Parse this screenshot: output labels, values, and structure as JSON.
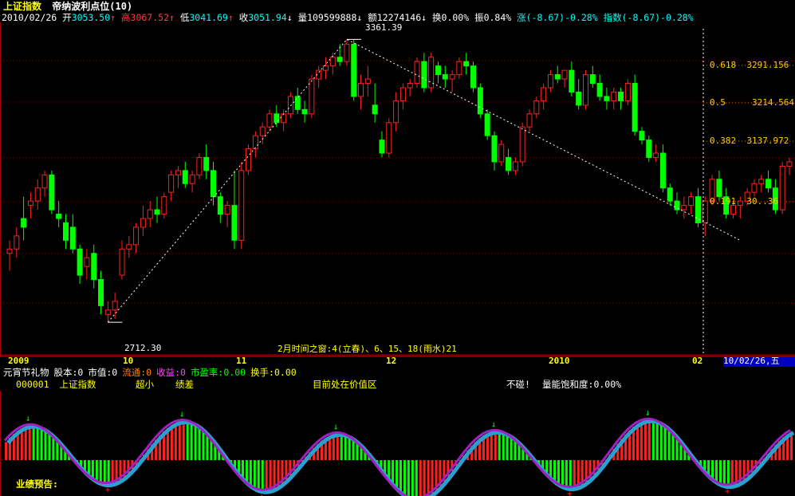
{
  "header": {
    "title": "上证指数",
    "indicator": "帝纳波利点位(10)",
    "date": "2010/02/26",
    "open_label": "开",
    "open": "3053.50",
    "high_label": "高",
    "high": "3067.52",
    "low_label": "低",
    "low": "3041.69",
    "close_label": "收",
    "close": "3051.94",
    "volume_label": "量",
    "volume": "109599888",
    "amount_label": "额",
    "amount": "12274146",
    "turnover_label": "换",
    "turnover": "0.00%",
    "amplitude_label": "振",
    "amplitude": "0.84%",
    "change_label": "涨",
    "change": "(-8.67)-0.28%",
    "index_label": "指数",
    "index_change": "(-8.67)-0.28%"
  },
  "annotations": {
    "peak": "3361.39",
    "trough": "2712.30",
    "time_window": "2月时间之窗:4(立春)、6、15、18(雨水)21"
  },
  "fib_levels": [
    {
      "ratio": "0.618",
      "value": "3291.156"
    },
    {
      "ratio": "0.5",
      "value": "3214.564"
    },
    {
      "ratio": "0.382",
      "value": "3137.972"
    },
    {
      "ratio": "0.191",
      "value": "30..36"
    }
  ],
  "time_axis": {
    "labels": [
      "2009",
      "10",
      "11",
      "12",
      "2010",
      "02"
    ],
    "cursor": "10/02/26,五"
  },
  "info_bar": {
    "line1": [
      {
        "text": "元宵节礼物",
        "color": "#ffffff"
      },
      {
        "text": "股本:0",
        "color": "#ffffff"
      },
      {
        "text": "市值:0",
        "color": "#ffffff"
      },
      {
        "text": "流通:0",
        "color": "#ff8000"
      },
      {
        "text": "收益:0",
        "color": "#ff40ff"
      },
      {
        "text": "市盈率:0.00",
        "color": "#00ff00"
      },
      {
        "text": "换手:0.00",
        "color": "#ffff00"
      }
    ],
    "code": "000001",
    "name": "上证指数",
    "size": "超小",
    "performance": "绩差",
    "status": "目前处在价值区",
    "warning": "不碰!",
    "saturation_label": "量能饱和度:",
    "saturation": "0.00%"
  },
  "footer": {
    "forecast_label": "业绩预告:"
  },
  "chart_data": {
    "type": "candlestick",
    "title": "上证指数",
    "ylim": [
      2650,
      3400
    ],
    "candles": [
      [
        2870,
        2900,
        2830,
        2880
      ],
      [
        2880,
        2930,
        2860,
        2910
      ],
      [
        2950,
        3000,
        2900,
        2930
      ],
      [
        2980,
        3010,
        2950,
        2990
      ],
      [
        2990,
        3040,
        2970,
        3020
      ],
      [
        3020,
        3060,
        3000,
        3050
      ],
      [
        3050,
        3060,
        2960,
        2970
      ],
      [
        2960,
        2990,
        2930,
        2950
      ],
      [
        2940,
        2960,
        2880,
        2900
      ],
      [
        2930,
        2960,
        2870,
        2880
      ],
      [
        2880,
        2890,
        2800,
        2820
      ],
      [
        2840,
        2880,
        2810,
        2860
      ],
      [
        2870,
        2890,
        2790,
        2810
      ],
      [
        2810,
        2830,
        2730,
        2750
      ],
      [
        2730,
        2760,
        2712,
        2740
      ],
      [
        2740,
        2780,
        2720,
        2760
      ],
      [
        2820,
        2900,
        2810,
        2880
      ],
      [
        2880,
        2910,
        2860,
        2890
      ],
      [
        2890,
        2940,
        2870,
        2930
      ],
      [
        2930,
        2980,
        2910,
        2950
      ],
      [
        2950,
        2990,
        2930,
        2970
      ],
      [
        2970,
        3000,
        2940,
        2960
      ],
      [
        2960,
        3010,
        2950,
        3000
      ],
      [
        3010,
        3060,
        2990,
        3050
      ],
      [
        3050,
        3070,
        3020,
        3060
      ],
      [
        3060,
        3080,
        3020,
        3030
      ],
      [
        3030,
        3060,
        3010,
        3050
      ],
      [
        3050,
        3100,
        3040,
        3090
      ],
      [
        3090,
        3120,
        3040,
        3060
      ],
      [
        3060,
        3080,
        2980,
        3000
      ],
      [
        3000,
        3010,
        2940,
        2960
      ],
      [
        2960,
        2990,
        2930,
        2980
      ],
      [
        2980,
        3060,
        2880,
        2900
      ],
      [
        2900,
        3080,
        2880,
        3060
      ],
      [
        3060,
        3120,
        3050,
        3110
      ],
      [
        3110,
        3150,
        3090,
        3140
      ],
      [
        3140,
        3170,
        3120,
        3160
      ],
      [
        3160,
        3200,
        3150,
        3190
      ],
      [
        3190,
        3210,
        3160,
        3170
      ],
      [
        3170,
        3200,
        3150,
        3190
      ],
      [
        3190,
        3240,
        3180,
        3230
      ],
      [
        3230,
        3250,
        3190,
        3200
      ],
      [
        3200,
        3220,
        3170,
        3190
      ],
      [
        3190,
        3280,
        3180,
        3270
      ],
      [
        3270,
        3300,
        3250,
        3290
      ],
      [
        3290,
        3320,
        3270,
        3300
      ],
      [
        3300,
        3330,
        3280,
        3320
      ],
      [
        3320,
        3350,
        3300,
        3310
      ],
      [
        3310,
        3361,
        3300,
        3350
      ],
      [
        3350,
        3361,
        3220,
        3230
      ],
      [
        3230,
        3280,
        3200,
        3260
      ],
      [
        3260,
        3300,
        3230,
        3270
      ],
      [
        3210,
        3260,
        3170,
        3190
      ],
      [
        3130,
        3150,
        3090,
        3100
      ],
      [
        3100,
        3180,
        3090,
        3170
      ],
      [
        3170,
        3240,
        3150,
        3220
      ],
      [
        3220,
        3260,
        3200,
        3250
      ],
      [
        3250,
        3270,
        3230,
        3260
      ],
      [
        3260,
        3320,
        3250,
        3310
      ],
      [
        3310,
        3330,
        3240,
        3250
      ],
      [
        3250,
        3330,
        3240,
        3320
      ],
      [
        3300,
        3310,
        3260,
        3280
      ],
      [
        3280,
        3300,
        3250,
        3270
      ],
      [
        3270,
        3290,
        3240,
        3280
      ],
      [
        3280,
        3320,
        3270,
        3310
      ],
      [
        3310,
        3330,
        3280,
        3300
      ],
      [
        3300,
        3310,
        3240,
        3250
      ],
      [
        3250,
        3260,
        3180,
        3190
      ],
      [
        3190,
        3200,
        3130,
        3140
      ],
      [
        3140,
        3150,
        3060,
        3080
      ],
      [
        3080,
        3130,
        3070,
        3120
      ],
      [
        3090,
        3110,
        3050,
        3060
      ],
      [
        3060,
        3090,
        3050,
        3080
      ],
      [
        3080,
        3170,
        3070,
        3160
      ],
      [
        3160,
        3200,
        3150,
        3190
      ],
      [
        3190,
        3230,
        3180,
        3220
      ],
      [
        3220,
        3260,
        3200,
        3250
      ],
      [
        3250,
        3290,
        3240,
        3280
      ],
      [
        3280,
        3300,
        3260,
        3270
      ],
      [
        3270,
        3290,
        3250,
        3290
      ],
      [
        3290,
        3310,
        3230,
        3240
      ],
      [
        3240,
        3270,
        3200,
        3210
      ],
      [
        3210,
        3290,
        3200,
        3280
      ],
      [
        3280,
        3300,
        3250,
        3260
      ],
      [
        3260,
        3280,
        3220,
        3230
      ],
      [
        3230,
        3250,
        3200,
        3220
      ],
      [
        3220,
        3250,
        3200,
        3240
      ],
      [
        3240,
        3250,
        3200,
        3220
      ],
      [
        3220,
        3270,
        3210,
        3260
      ],
      [
        3260,
        3280,
        3140,
        3150
      ],
      [
        3150,
        3160,
        3120,
        3130
      ],
      [
        3130,
        3140,
        3080,
        3090
      ],
      [
        3090,
        3120,
        3080,
        3100
      ],
      [
        3100,
        3120,
        3010,
        3020
      ],
      [
        3020,
        3030,
        2980,
        2990
      ],
      [
        2990,
        3010,
        2960,
        2970
      ],
      [
        2970,
        3000,
        2950,
        2980
      ],
      [
        2980,
        3010,
        2960,
        3000
      ],
      [
        3000,
        3020,
        2930,
        2940
      ],
      [
        2940,
        3000,
        2910,
        2990
      ],
      [
        2990,
        3050,
        2980,
        3040
      ],
      [
        3040,
        3060,
        2990,
        3000
      ],
      [
        3000,
        3020,
        2950,
        2960
      ],
      [
        2960,
        2990,
        2950,
        2980
      ],
      [
        2980,
        3000,
        2950,
        2990
      ],
      [
        2990,
        3020,
        2980,
        3010
      ],
      [
        3010,
        3040,
        3000,
        3030
      ],
      [
        3030,
        3050,
        3010,
        3040
      ],
      [
        3040,
        3060,
        3010,
        3020
      ],
      [
        3020,
        3040,
        2960,
        2970
      ],
      [
        2970,
        3080,
        2960,
        3070
      ],
      [
        3070,
        3090,
        3050,
        3080
      ]
    ]
  }
}
